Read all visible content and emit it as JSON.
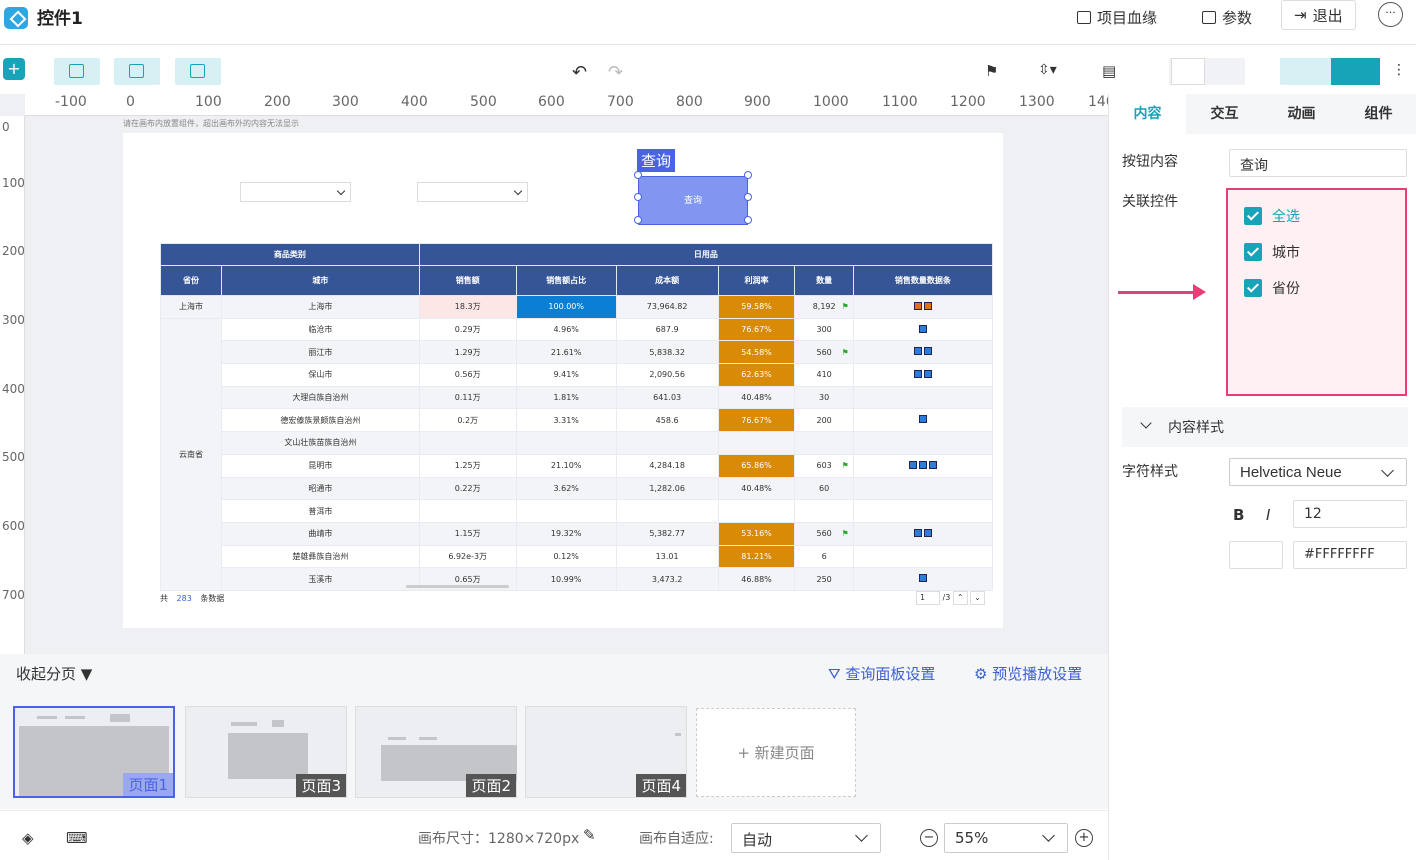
{
  "app": {
    "title": "控件1"
  },
  "topbar": {
    "lineage": "项目血缘",
    "params": "参数",
    "exit": "退出"
  },
  "canvas": {
    "hint": "请在画布内放置组件，超出画布外的内容无法显示",
    "query_label": "查询",
    "query_button": "查询"
  },
  "ruler": {
    "h": [
      "-100",
      "0",
      "100",
      "200",
      "300",
      "400",
      "500",
      "600",
      "700",
      "800",
      "900",
      "1000",
      "1100",
      "1200",
      "1300",
      "140"
    ],
    "v": [
      "0",
      "100",
      "200",
      "300",
      "400",
      "500",
      "600",
      "700"
    ]
  },
  "table": {
    "group_headers": [
      "商品类别",
      "日用品"
    ],
    "headers": [
      "省份",
      "城市",
      "销售额",
      "销售额占比",
      "成本额",
      "利润率",
      "数量",
      "销售数量数据条"
    ],
    "rows": [
      {
        "province": "上海市",
        "city": "上海市",
        "sales": "18.3万",
        "share": "100.00%",
        "cost": "73,964.82",
        "margin": "59.58%",
        "qty": "8,192",
        "flag": true,
        "bars": 2,
        "orange": true
      },
      {
        "province": "云南省",
        "city": "临沧市",
        "sales": "0.29万",
        "share": "4.96%",
        "cost": "687.9",
        "margin": "76.67%",
        "qty": "300",
        "flag": false,
        "bars": 1
      },
      {
        "city": "丽江市",
        "sales": "1.29万",
        "share": "21.61%",
        "cost": "5,838.32",
        "margin": "54.58%",
        "qty": "560",
        "flag": true,
        "bars": 2
      },
      {
        "city": "保山市",
        "sales": "0.56万",
        "share": "9.41%",
        "cost": "2,090.56",
        "margin": "62.63%",
        "qty": "410",
        "flag": false,
        "bars": 2
      },
      {
        "city": "大理白族自治州",
        "sales": "0.11万",
        "share": "1.81%",
        "cost": "641.03",
        "margin": "40.48%",
        "qty": "30",
        "flag": false,
        "bars": 0
      },
      {
        "city": "德宏傣族景颇族自治州",
        "sales": "0.2万",
        "share": "3.31%",
        "cost": "458.6",
        "margin": "76.67%",
        "qty": "200",
        "flag": false,
        "bars": 1
      },
      {
        "city": "文山壮族苗族自治州",
        "sales": "",
        "share": "",
        "cost": "",
        "margin": "",
        "qty": "",
        "flag": false,
        "bars": 0
      },
      {
        "city": "昆明市",
        "sales": "1.25万",
        "share": "21.10%",
        "cost": "4,284.18",
        "margin": "65.86%",
        "qty": "603",
        "flag": true,
        "bars": 3
      },
      {
        "city": "昭通市",
        "sales": "0.22万",
        "share": "3.62%",
        "cost": "1,282.06",
        "margin": "40.48%",
        "qty": "60",
        "flag": false,
        "bars": 0
      },
      {
        "city": "普洱市",
        "sales": "",
        "share": "",
        "cost": "",
        "margin": "",
        "qty": "",
        "flag": false,
        "bars": 0
      },
      {
        "city": "曲靖市",
        "sales": "1.15万",
        "share": "19.32%",
        "cost": "5,382.77",
        "margin": "53.16%",
        "qty": "560",
        "flag": true,
        "bars": 2
      },
      {
        "city": "楚雄彝族自治州",
        "sales": "6.92e-3万",
        "share": "0.12%",
        "cost": "13.01",
        "margin": "81.21%",
        "qty": "6",
        "flag": false,
        "bars": 0
      },
      {
        "city": "玉溪市",
        "sales": "0.65万",
        "share": "10.99%",
        "cost": "3,473.2",
        "margin": "46.88%",
        "qty": "250",
        "flag": false,
        "bars": 1
      }
    ],
    "footer": {
      "prefix": "共",
      "count": "283",
      "suffix": "条数据",
      "page": "1",
      "total": "/3"
    }
  },
  "pagebar": {
    "collapse": "收起分页",
    "query_settings": "查询面板设置",
    "preview_settings": "预览播放设置",
    "pages": [
      "页面1",
      "页面3",
      "页面2",
      "页面4"
    ],
    "new_page": "+ 新建页面"
  },
  "status": {
    "size_label": "画布尺寸：1280×720px",
    "adapt_label": "画布自适应:",
    "adapt_value": "自动",
    "zoom": "55%"
  },
  "panel": {
    "tabs": [
      "内容",
      "交互",
      "动画",
      "组件"
    ],
    "button_content_label": "按钮内容",
    "button_content_value": "查询",
    "assoc_label": "关联控件",
    "assoc_items": [
      "全选",
      "城市",
      "省份"
    ],
    "content_style": "内容样式",
    "font_label": "字符样式",
    "font_value": "Helvetica Neue",
    "bold": "B",
    "italic": "I",
    "font_size": "12",
    "color_hex": "#FFFFFFFF"
  },
  "colors": {
    "accent": "#17a3b8",
    "select": "#4a63e4",
    "header": "#365597",
    "highlight": "#e83e78",
    "margin_hi": "#d98b07",
    "share_hi": "#0a7fd4"
  }
}
